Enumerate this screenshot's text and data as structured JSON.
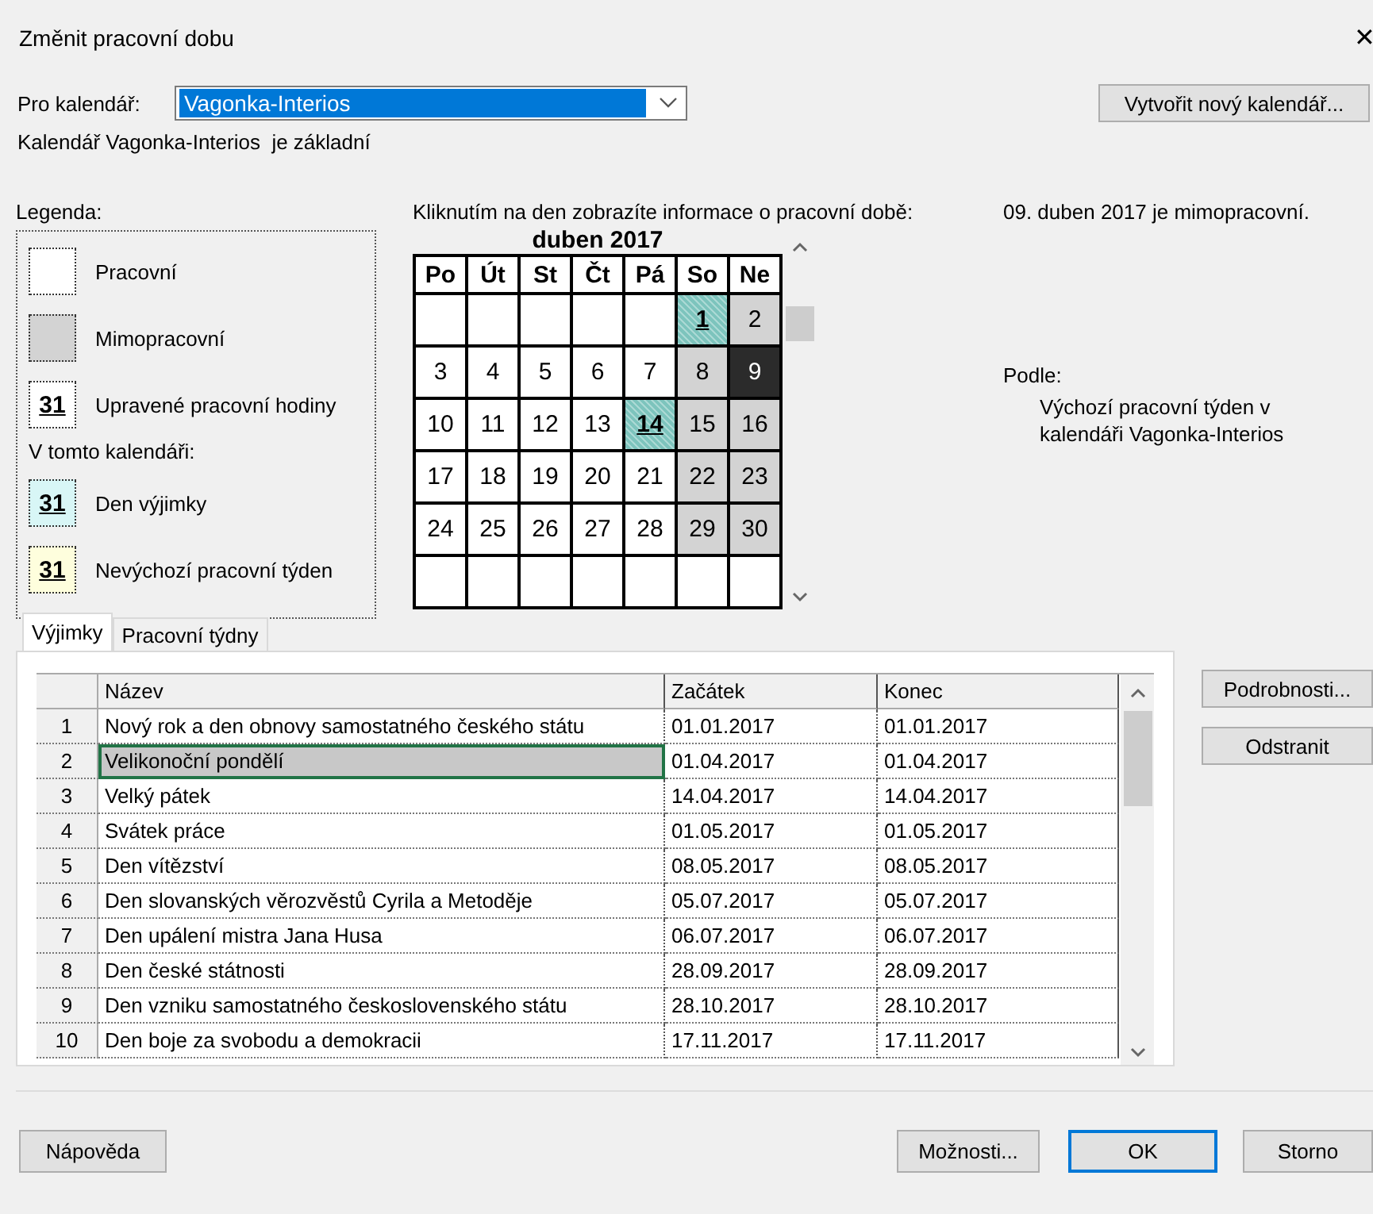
{
  "window": {
    "title": "Změnit pracovní dobu",
    "close": "✕"
  },
  "calendar_select": {
    "label": "Pro kalendář:",
    "value": "Vagonka-Interios",
    "new_button": "Vytvořit nový kalendář..."
  },
  "base_note": "Kalendář Vagonka-Interios  je základní",
  "legend": {
    "title": "Legenda:",
    "items": [
      {
        "kind": "working",
        "label": "Pracovní"
      },
      {
        "kind": "nonworking",
        "label": "Mimopracovní"
      },
      {
        "kind": "edited",
        "mark": "31",
        "label": "Upravené pracovní hodiny"
      }
    ],
    "calendar_heading": "V tomto kalendáři:",
    "calendar_items": [
      {
        "kind": "exception",
        "mark": "31",
        "label": "Den výjimky"
      },
      {
        "kind": "nondefault",
        "mark": "31",
        "label": "Nevýchozí pracovní týden"
      }
    ]
  },
  "instruction": "Kliknutím na den zobrazíte informace o pracovní době:",
  "month": {
    "title": "duben 2017",
    "weekdays": [
      "Po",
      "Út",
      "St",
      "Čt",
      "Pá",
      "So",
      "Ne"
    ],
    "weeks": [
      [
        {
          "kind": "blank"
        },
        {
          "kind": "blank"
        },
        {
          "kind": "blank"
        },
        {
          "kind": "blank"
        },
        {
          "kind": "blank"
        },
        {
          "kind": "exception",
          "day": "1",
          "selected": false
        },
        {
          "kind": "nonworking",
          "day": "2",
          "selected": false
        }
      ],
      [
        {
          "kind": "working",
          "day": "3",
          "selected": false
        },
        {
          "kind": "working",
          "day": "4",
          "selected": false
        },
        {
          "kind": "working",
          "day": "5",
          "selected": false
        },
        {
          "kind": "working",
          "day": "6",
          "selected": false
        },
        {
          "kind": "working",
          "day": "7",
          "selected": false
        },
        {
          "kind": "nonworking",
          "day": "8",
          "selected": false
        },
        {
          "kind": "nonworking",
          "day": "9",
          "selected": true
        }
      ],
      [
        {
          "kind": "working",
          "day": "10",
          "selected": false
        },
        {
          "kind": "working",
          "day": "11",
          "selected": false
        },
        {
          "kind": "working",
          "day": "12",
          "selected": false
        },
        {
          "kind": "working",
          "day": "13",
          "selected": false
        },
        {
          "kind": "exception",
          "day": "14",
          "selected": false
        },
        {
          "kind": "nonworking",
          "day": "15",
          "selected": false
        },
        {
          "kind": "nonworking",
          "day": "16",
          "selected": false
        }
      ],
      [
        {
          "kind": "working",
          "day": "17",
          "selected": false
        },
        {
          "kind": "working",
          "day": "18",
          "selected": false
        },
        {
          "kind": "working",
          "day": "19",
          "selected": false
        },
        {
          "kind": "working",
          "day": "20",
          "selected": false
        },
        {
          "kind": "working",
          "day": "21",
          "selected": false
        },
        {
          "kind": "nonworking",
          "day": "22",
          "selected": false
        },
        {
          "kind": "nonworking",
          "day": "23",
          "selected": false
        }
      ],
      [
        {
          "kind": "working",
          "day": "24",
          "selected": false
        },
        {
          "kind": "working",
          "day": "25",
          "selected": false
        },
        {
          "kind": "working",
          "day": "26",
          "selected": false
        },
        {
          "kind": "working",
          "day": "27",
          "selected": false
        },
        {
          "kind": "working",
          "day": "28",
          "selected": false
        },
        {
          "kind": "nonworking",
          "day": "29",
          "selected": false
        },
        {
          "kind": "nonworking",
          "day": "30",
          "selected": false
        }
      ],
      [
        {
          "kind": "blank"
        },
        {
          "kind": "blank"
        },
        {
          "kind": "blank"
        },
        {
          "kind": "blank"
        },
        {
          "kind": "blank"
        },
        {
          "kind": "blank"
        },
        {
          "kind": "blank"
        }
      ]
    ]
  },
  "day_info": {
    "status": "09. duben 2017 je mimopracovní.",
    "basis_label": "Podle:",
    "basis_lines": [
      "Výchozí pracovní týden v",
      "kalendáři Vagonka-Interios"
    ]
  },
  "tabs": [
    {
      "label": "Výjimky",
      "selected": true
    },
    {
      "label": "Pracovní týdny",
      "selected": false
    }
  ],
  "table": {
    "columns": [
      "Název",
      "Začátek",
      "Konec"
    ],
    "rows": [
      {
        "num": "1",
        "name": "Nový rok a den obnovy samostatného českého státu",
        "start": "01.01.2017",
        "end": "01.01.2017",
        "selected": false
      },
      {
        "num": "2",
        "name": "Velikonoční pondělí",
        "start": "01.04.2017",
        "end": "01.04.2017",
        "selected": true
      },
      {
        "num": "3",
        "name": "Velký pátek",
        "start": "14.04.2017",
        "end": "14.04.2017",
        "selected": false
      },
      {
        "num": "4",
        "name": "Svátek práce",
        "start": "01.05.2017",
        "end": "01.05.2017",
        "selected": false
      },
      {
        "num": "5",
        "name": "Den vítězství",
        "start": "08.05.2017",
        "end": "08.05.2017",
        "selected": false
      },
      {
        "num": "6",
        "name": "Den slovanských věrozvěstů Cyrila a Metoděje",
        "start": "05.07.2017",
        "end": "05.07.2017",
        "selected": false
      },
      {
        "num": "7",
        "name": "Den upálení mistra Jana Husa",
        "start": "06.07.2017",
        "end": "06.07.2017",
        "selected": false
      },
      {
        "num": "8",
        "name": "Den české státnosti",
        "start": "28.09.2017",
        "end": "28.09.2017",
        "selected": false
      },
      {
        "num": "9",
        "name": "Den vzniku samostatného československého státu",
        "start": "28.10.2017",
        "end": "28.10.2017",
        "selected": false
      },
      {
        "num": "10",
        "name": "Den boje za svobodu a demokracii",
        "start": "17.11.2017",
        "end": "17.11.2017",
        "selected": false
      }
    ]
  },
  "side_buttons": [
    "Podrobnosti...",
    "Odstranit"
  ],
  "footer": {
    "help": "Nápověda",
    "options": "Možnosti...",
    "ok": "OK",
    "cancel": "Storno"
  }
}
